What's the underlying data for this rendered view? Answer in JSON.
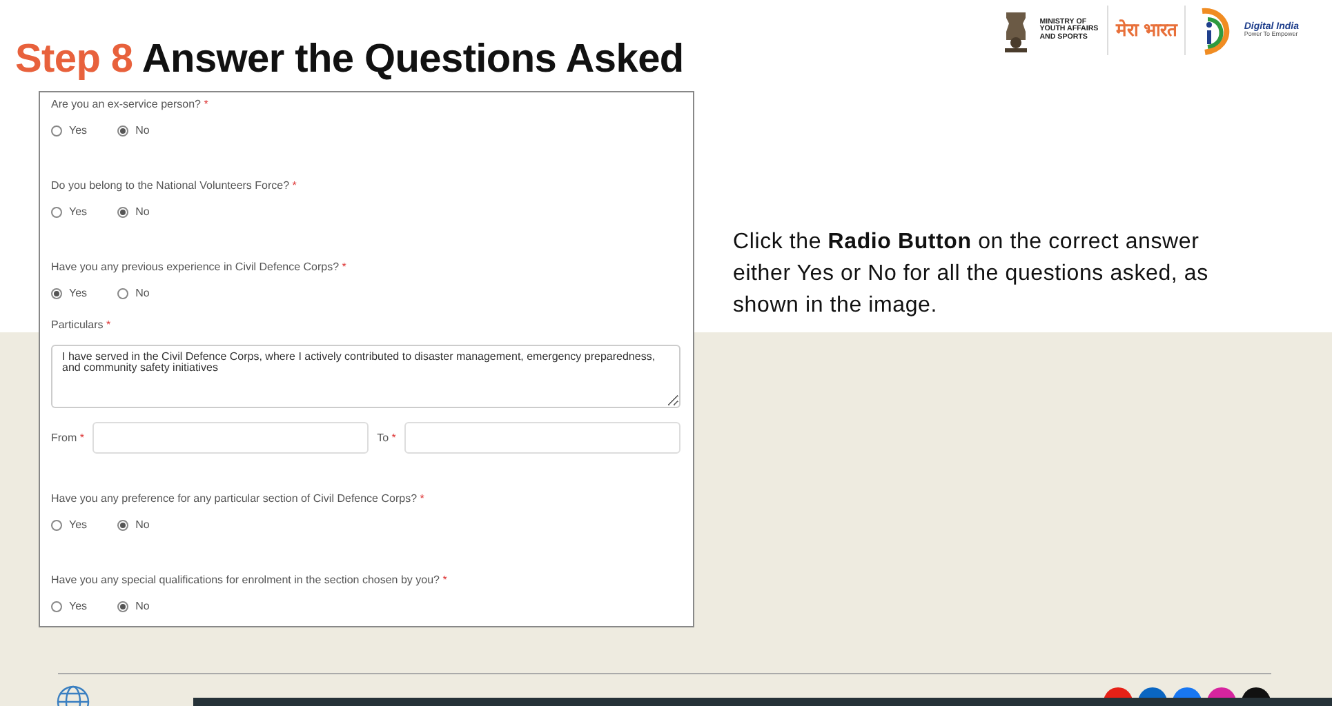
{
  "title": {
    "step": "Step 8",
    "text": "Answer the Questions Asked"
  },
  "logos": {
    "ministry": [
      "MINISTRY OF",
      "YOUTH AFFAIRS",
      "AND SPORTS"
    ],
    "mybharat": "मेरा भारत",
    "digital_india": "Digital India",
    "digital_india_tagline": "Power To Empower"
  },
  "form": {
    "items": [
      {
        "kind": "radio",
        "label": "Are you an ex-service person?",
        "mark": "*",
        "options": [
          {
            "label": "Yes",
            "selected": false
          },
          {
            "label": "No",
            "selected": true
          }
        ]
      },
      {
        "kind": "radio",
        "label": "Do you belong to the National Volunteers Force?",
        "mark": "*",
        "options": [
          {
            "label": "Yes",
            "selected": false
          },
          {
            "label": "No",
            "selected": true
          }
        ]
      },
      {
        "kind": "radio",
        "label": "Have you any previous experience in Civil Defence Corps?",
        "mark": "*",
        "options": [
          {
            "label": "Yes",
            "selected": true
          },
          {
            "label": "No",
            "selected": false
          }
        ]
      },
      {
        "kind": "textarea",
        "label": "Particulars",
        "mark": "*",
        "value": "I have served in the Civil Defence Corps, where I actively contributed to disaster management, emergency preparedness, and community safety initiatives"
      },
      {
        "kind": "range",
        "fields": [
          {
            "label": "From",
            "mark": "*"
          },
          {
            "label": "To",
            "mark": "*"
          }
        ]
      },
      {
        "kind": "radio",
        "label": "Have you any preference for any particular section of Civil Defence Corps?",
        "mark": "*",
        "options": [
          {
            "label": "Yes",
            "selected": false
          },
          {
            "label": "No",
            "selected": true
          }
        ]
      },
      {
        "kind": "radio",
        "label": "Have you any special qualifications for enrolment in the section chosen by you?",
        "mark": "*",
        "options": [
          {
            "label": "Yes",
            "selected": false
          },
          {
            "label": "No",
            "selected": true
          }
        ]
      }
    ]
  },
  "instruction": "Click the **Radio Button** on the correct answer either Yes or No for all the questions asked, as shown in the image."
}
